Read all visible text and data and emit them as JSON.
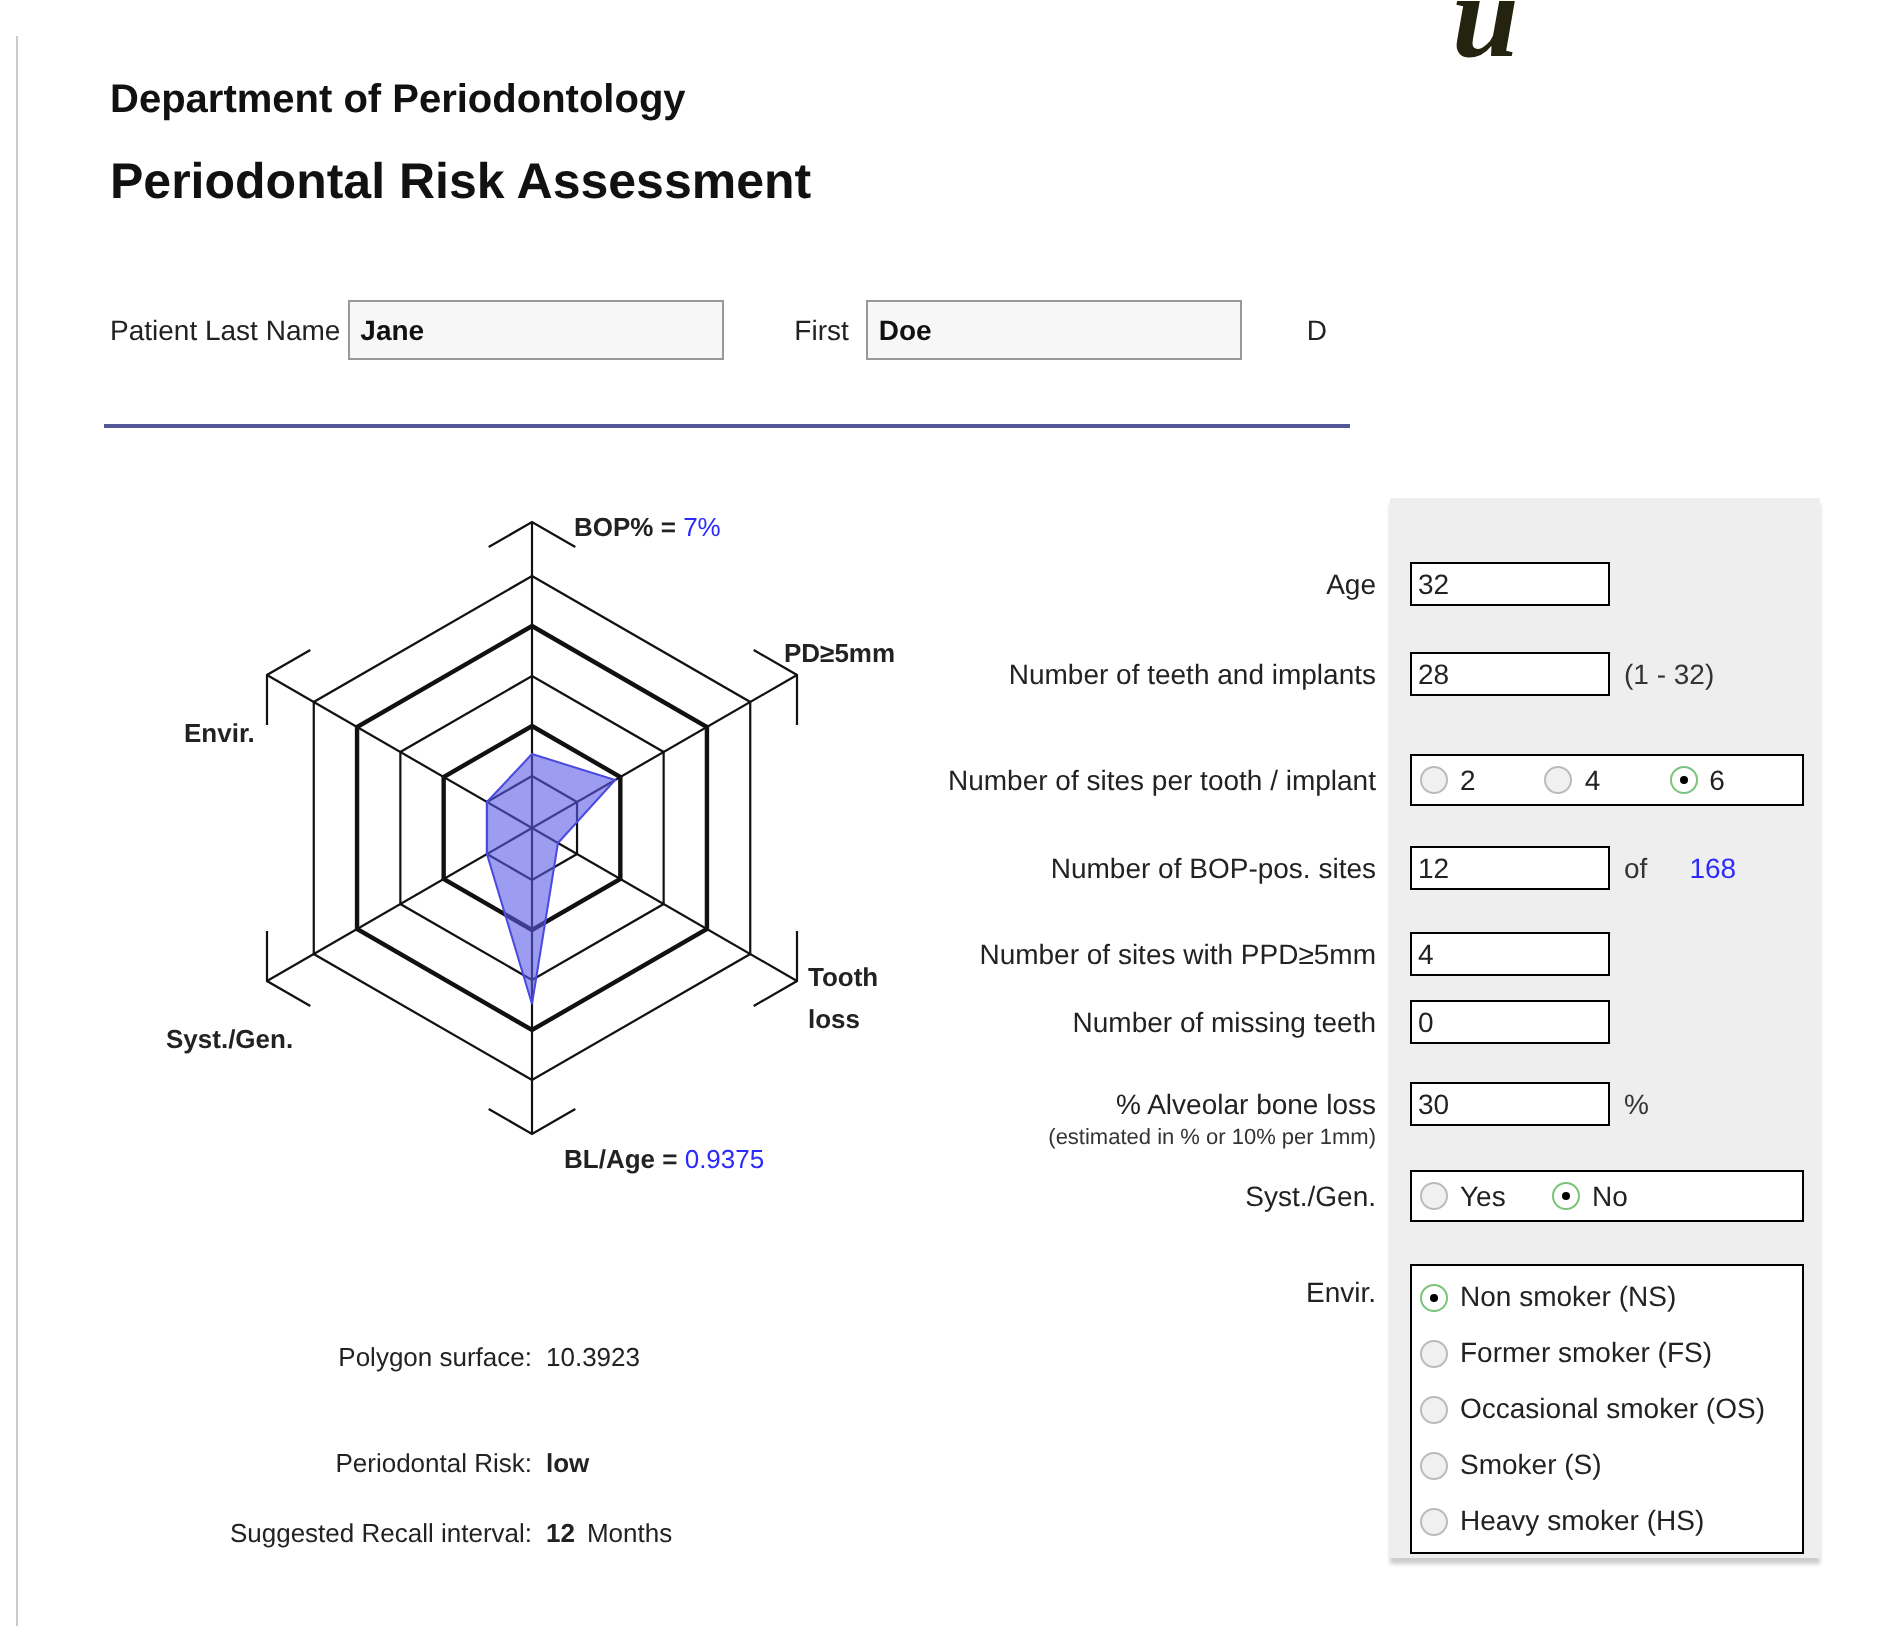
{
  "logo": "u",
  "header": {
    "department": "Department of Periodontology",
    "title": "Periodontal Risk Assessment"
  },
  "patient": {
    "last_name": {
      "label": "Patient Last Name",
      "value": "Jane"
    },
    "first_name": {
      "label": "First",
      "value": "Doe"
    },
    "date_label": "D"
  },
  "chart": {
    "axes": [
      {
        "label": "BOP% =",
        "value": "7%"
      },
      {
        "label": "PD≥5mm"
      },
      {
        "label": "Tooth loss"
      },
      {
        "label": "BL/Age =",
        "value": "0.9375"
      },
      {
        "label": "Syst./Gen."
      },
      {
        "label": "Envir."
      }
    ]
  },
  "summary": [
    {
      "kind": "measure",
      "label": "Polygon surface:",
      "value": "10.3923"
    },
    {
      "kind": "result",
      "label": "Periodontal Risk:",
      "value": "low"
    },
    {
      "kind": "result",
      "label": "Suggested Recall interval:",
      "value": "12",
      "unit": "Months"
    }
  ],
  "form": {
    "rows": [
      {
        "kind": "text",
        "label": "Age",
        "value": "32"
      },
      {
        "kind": "text",
        "label": "Number of teeth and implants",
        "value": "28",
        "suffix": "(1 - 32)"
      },
      {
        "kind": "radio_row",
        "label": "Number of sites per tooth / implant",
        "options": [
          {
            "label": "2",
            "selected": false
          },
          {
            "label": "4",
            "selected": false
          },
          {
            "label": "6",
            "selected": true
          }
        ]
      },
      {
        "kind": "text",
        "label": "Number of BOP-pos. sites",
        "value": "12",
        "suffix": "of",
        "total": "168"
      },
      {
        "kind": "text",
        "label": "Number of sites with PPD≥5mm",
        "value": "4"
      },
      {
        "kind": "text",
        "label": "Number of missing teeth",
        "value": "0"
      },
      {
        "kind": "text",
        "label": "% Alveolar bone loss",
        "note": "(estimated in % or 10% per 1mm)",
        "value": "30",
        "suffix": "%"
      },
      {
        "kind": "radio_row",
        "label": "Syst./Gen.",
        "options": [
          {
            "label": "Yes",
            "selected": false
          },
          {
            "label": "No",
            "selected": true
          }
        ]
      },
      {
        "kind": "radio_list",
        "label": "Envir.",
        "options": [
          {
            "label": "Non smoker (NS)",
            "selected": true
          },
          {
            "label": "Former smoker (FS)",
            "selected": false
          },
          {
            "label": "Occasional smoker (OS)",
            "selected": false
          },
          {
            "label": "Smoker (S)",
            "selected": false
          },
          {
            "label": "Heavy smoker (HS)",
            "selected": false
          }
        ]
      }
    ]
  }
}
